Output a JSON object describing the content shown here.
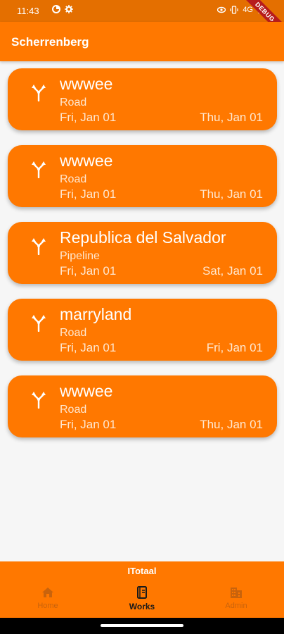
{
  "status_bar": {
    "time": "11:43",
    "network": "4G",
    "debug_banner": "DEBUG",
    "left_icons": [
      "data-saver-icon",
      "settings-icon"
    ],
    "right_icons": [
      "eye-icon",
      "vibrate-icon",
      "signal-icon",
      "battery-icon"
    ]
  },
  "app_bar": {
    "title": "Scherrenberg"
  },
  "works": [
    {
      "name": "wwwee",
      "type": "Road",
      "start_date": "Fri, Jan 01",
      "end_date": "Thu, Jan 01",
      "icon": "fork-icon"
    },
    {
      "name": "wwwee",
      "type": "Road",
      "start_date": "Fri, Jan 01",
      "end_date": "Thu, Jan 01",
      "icon": "fork-icon"
    },
    {
      "name": "Republica del Salvador",
      "type": "Pipeline",
      "start_date": "Fri, Jan 01",
      "end_date": "Sat, Jan 01",
      "icon": "fork-icon"
    },
    {
      "name": "marryland",
      "type": "Road",
      "start_date": "Fri, Jan 01",
      "end_date": "Fri, Jan 01",
      "icon": "fork-icon"
    },
    {
      "name": "wwwee",
      "type": "Road",
      "start_date": "Fri, Jan 01",
      "end_date": "Thu, Jan 01",
      "icon": "fork-icon"
    }
  ],
  "bottom_nav": {
    "header": "ITotaal",
    "items": [
      {
        "label": "Home",
        "icon": "home-icon",
        "active": false
      },
      {
        "label": "Works",
        "icon": "book-icon",
        "active": true
      },
      {
        "label": "Admin",
        "icon": "building-icon",
        "active": false
      }
    ]
  },
  "colors": {
    "primary": "#ff7800",
    "status_bar": "#e46f00",
    "background": "#f6f6f6"
  }
}
